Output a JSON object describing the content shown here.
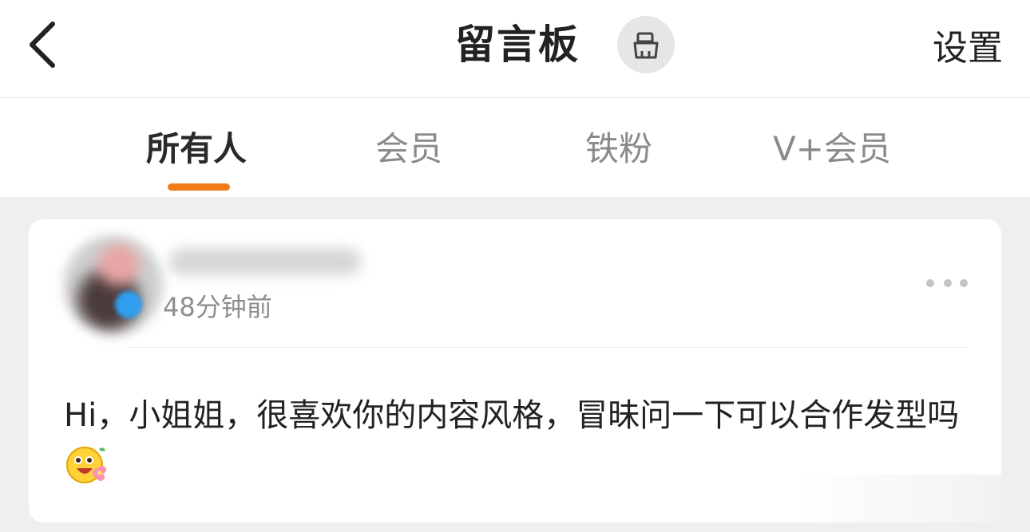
{
  "header": {
    "title": "留言板",
    "settings_label": "设置",
    "icons": {
      "back": "chevron-left-icon",
      "clean": "brush-icon"
    }
  },
  "tabs": [
    {
      "label": "所有人",
      "active": true
    },
    {
      "label": "会员",
      "active": false
    },
    {
      "label": "铁粉",
      "active": false
    },
    {
      "label": "V+会员",
      "active": false
    }
  ],
  "message": {
    "username": "",
    "timestamp": "48分钟前",
    "text": "Hi，小姐姐，很喜欢你的内容风格，冒昧问一下可以合作发型吗",
    "emoji": "smiling-face-with-flower-icon"
  },
  "colors": {
    "accent": "#f07c17",
    "background": "#efefef",
    "text_primary": "#222222",
    "text_secondary": "#8a8a8a"
  }
}
